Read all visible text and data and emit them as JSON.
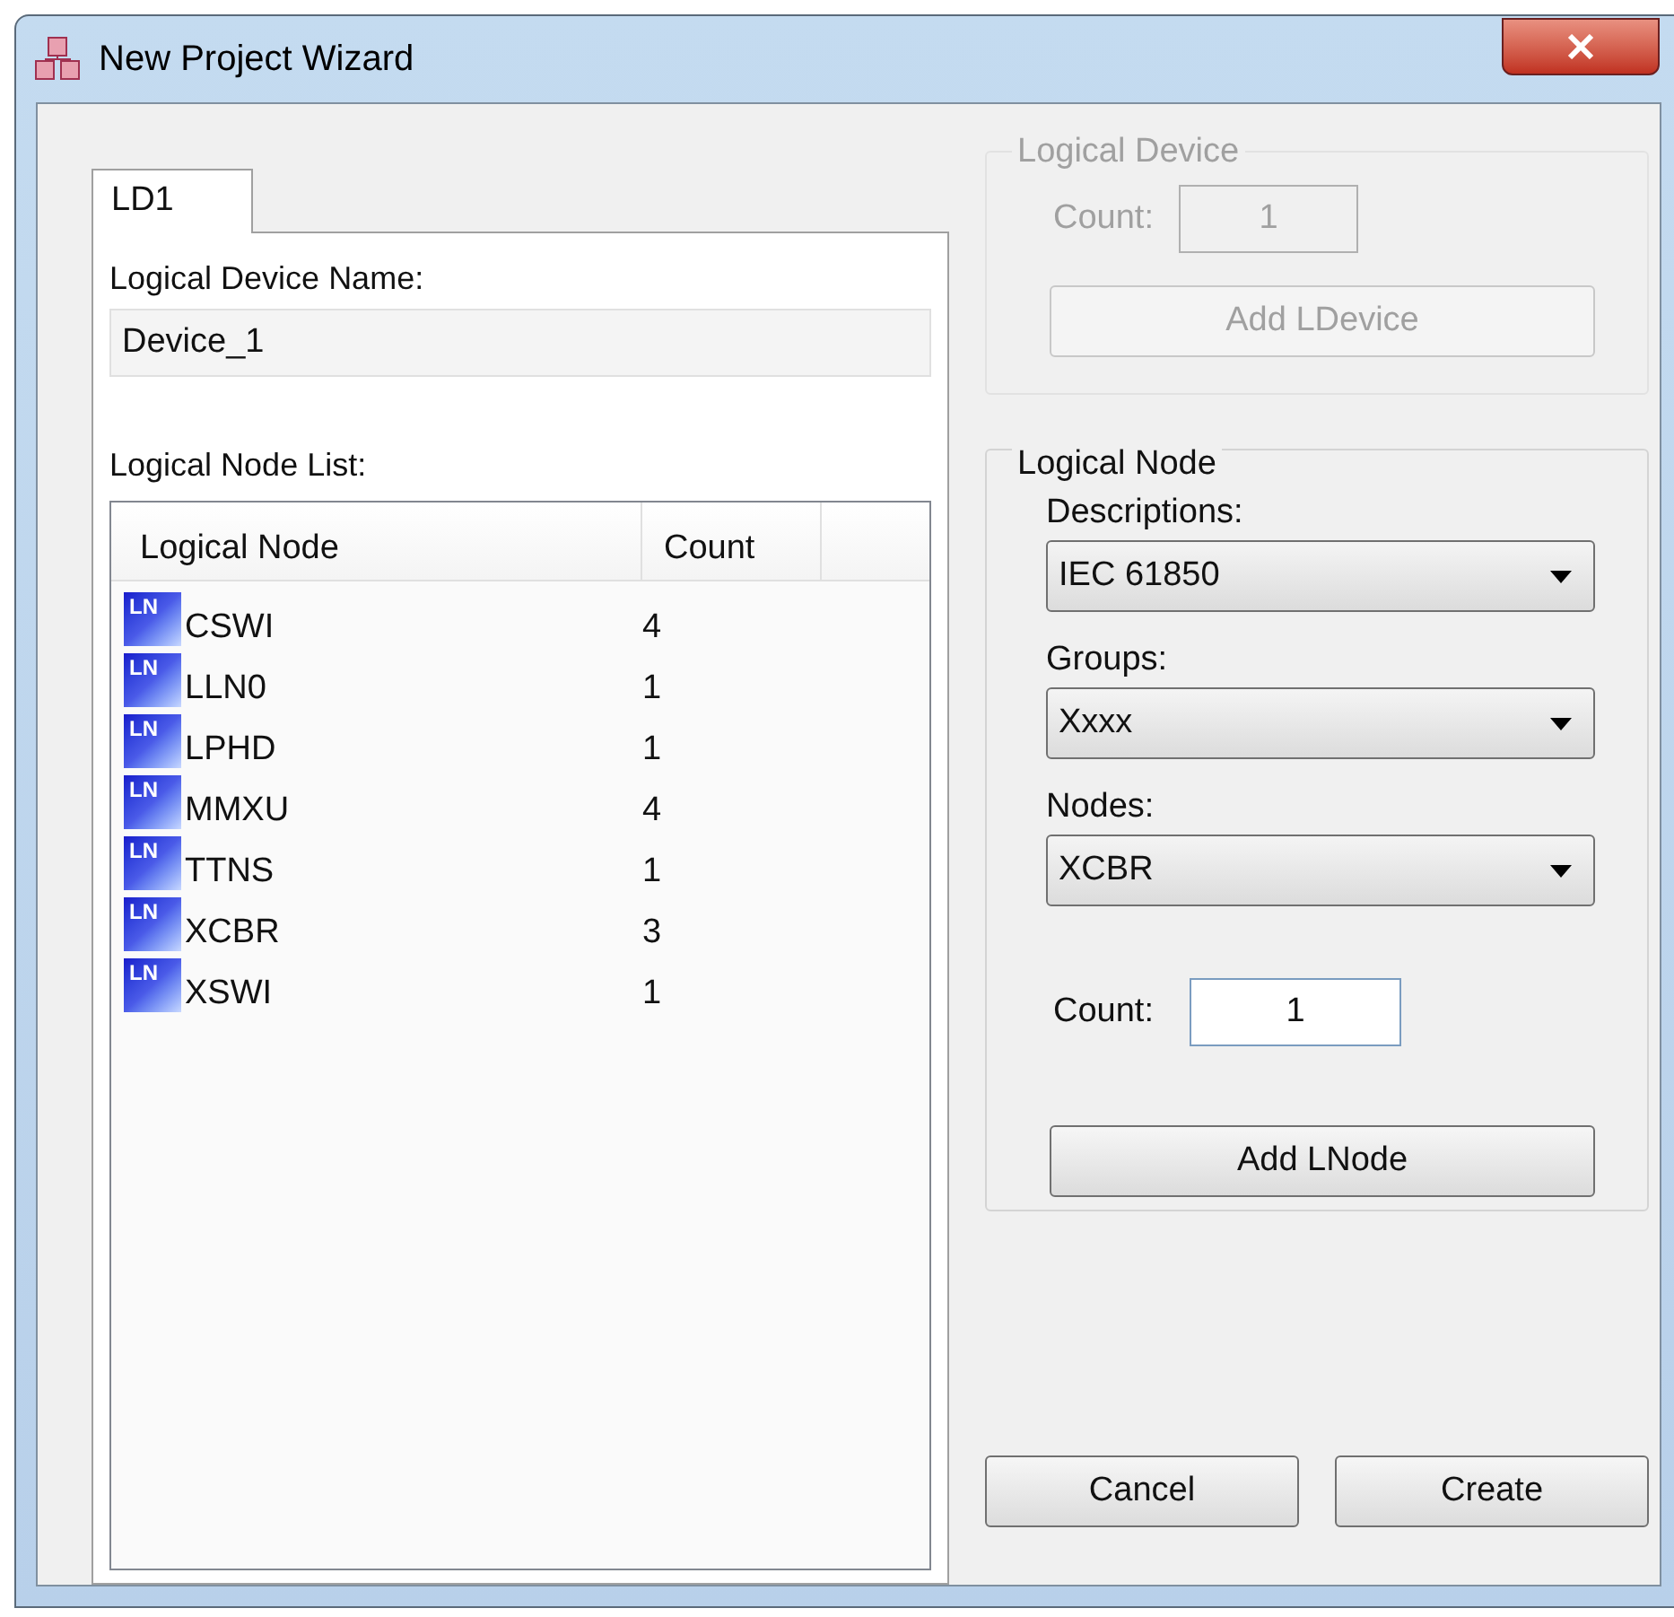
{
  "window": {
    "title": "New Project Wizard"
  },
  "tabs": [
    {
      "label": "LD1",
      "selected": true
    }
  ],
  "device_name": {
    "label": "Logical Device Name:",
    "value": "Device_1"
  },
  "node_list": {
    "label": "Logical Node List:",
    "columns": [
      "Logical Node",
      "Count"
    ],
    "rows": [
      {
        "badge": "LN",
        "name": "CSWI",
        "count": "4"
      },
      {
        "badge": "LN",
        "name": "LLN0",
        "count": "1"
      },
      {
        "badge": "LN",
        "name": "LPHD",
        "count": "1"
      },
      {
        "badge": "LN",
        "name": "MMXU",
        "count": "4"
      },
      {
        "badge": "LN",
        "name": "TTNS",
        "count": "1"
      },
      {
        "badge": "LN",
        "name": "XCBR",
        "count": "3"
      },
      {
        "badge": "LN",
        "name": "XSWI",
        "count": "1"
      }
    ]
  },
  "logical_device": {
    "title": "Logical Device",
    "disabled": true,
    "count_label": "Count:",
    "count_value": "1",
    "button": "Add LDevice"
  },
  "logical_node": {
    "title": "Logical Node",
    "disabled": false,
    "dropdowns": [
      {
        "label": "Descriptions:",
        "value": "IEC 61850"
      },
      {
        "label": "Groups:",
        "value": "Xxxx"
      },
      {
        "label": "Nodes:",
        "value": "XCBR"
      }
    ],
    "count_label": "Count:",
    "count_value": "1",
    "button": "Add LNode"
  },
  "buttons": [
    "Cancel",
    "Create"
  ]
}
